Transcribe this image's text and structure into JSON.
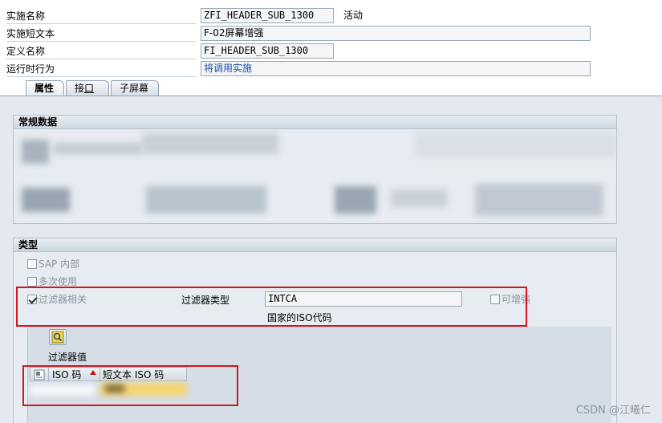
{
  "header": {
    "impl_name_label": "实施名称",
    "impl_name_value": "ZFI_HEADER_SUB_1300",
    "impl_status": "活动",
    "impl_short_text_label": "实施短文本",
    "impl_short_text_value": "F-02屏幕增强",
    "definition_name_label": "定义名称",
    "definition_name_value": "FI_HEADER_SUB_1300",
    "runtime_behavior_label": "运行时行为",
    "runtime_behavior_value": "将调用实施"
  },
  "tabs": [
    {
      "label": "属性",
      "active": true
    },
    {
      "label_prefix": "接",
      "label_underline": "口",
      "active": false
    },
    {
      "label": "子屏幕",
      "active": false
    }
  ],
  "general_data": {
    "title": "常规数据"
  },
  "type_group": {
    "title": "类型",
    "sap_internal": {
      "label": "SAP 内部",
      "checked": false
    },
    "multiple_use": {
      "label": "多次使用",
      "checked": false
    },
    "filter_dependent": {
      "label": "过滤器相关",
      "checked": true
    },
    "filter_type_label": "过滤器类型",
    "filter_type_value": "INTCA",
    "filter_type_desc": "国家的ISO代码",
    "enhanceable": {
      "label": "可增强",
      "checked": false
    },
    "filter_values_label": "过滤器值",
    "table": {
      "columns": [
        "ISO 码",
        "短文本 ISO 码"
      ]
    }
  },
  "watermark": "CSDN @江曦仁",
  "colors": {
    "highlight_box": "#d6141c",
    "link": "#1d4fa8"
  }
}
